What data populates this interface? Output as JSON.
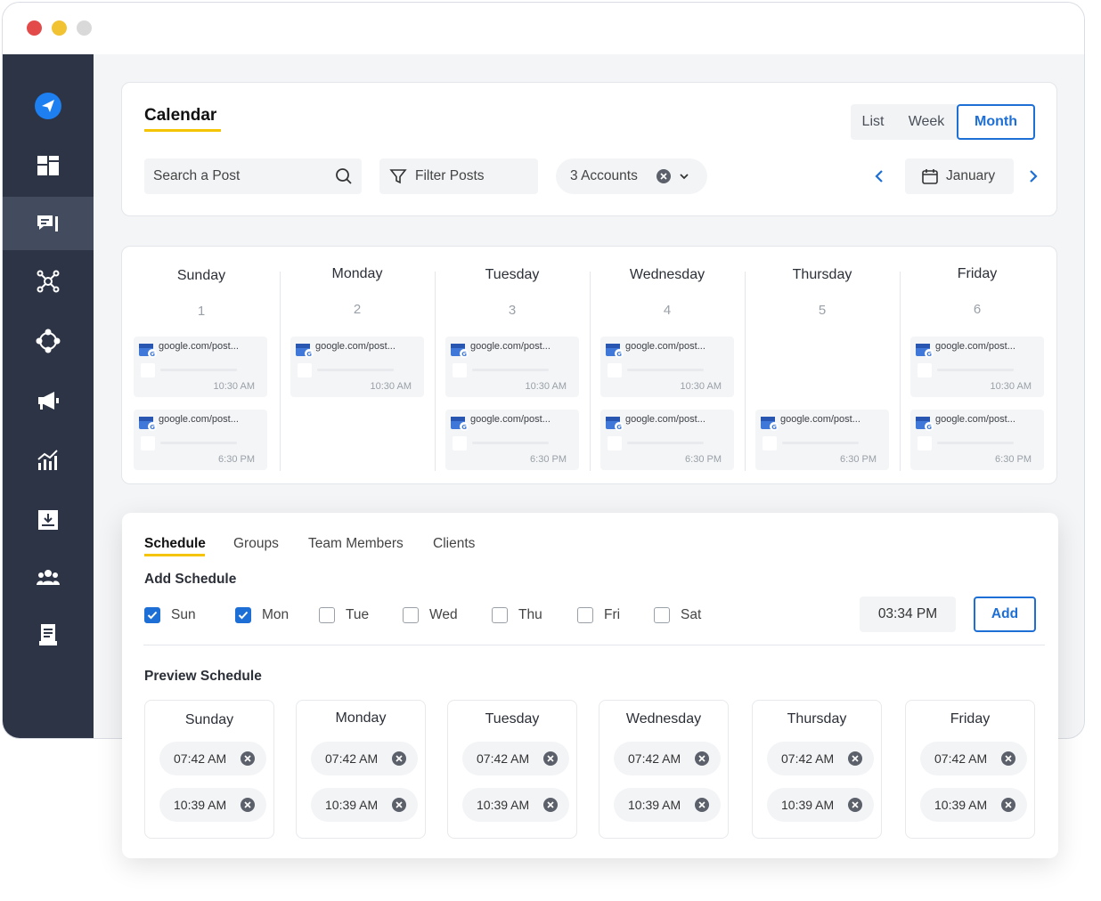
{
  "window": {
    "traffic_lights": [
      "#e34b4b",
      "#f1c232",
      "#d9d9d9"
    ]
  },
  "sidebar": {
    "items": [
      {
        "icon": "send-logo-icon"
      },
      {
        "icon": "dashboard-icon"
      },
      {
        "icon": "posts-icon",
        "active": true
      },
      {
        "icon": "network-icon"
      },
      {
        "icon": "integrations-icon"
      },
      {
        "icon": "megaphone-icon"
      },
      {
        "icon": "analytics-icon"
      },
      {
        "icon": "inbox-download-icon"
      },
      {
        "icon": "team-icon"
      },
      {
        "icon": "reports-icon"
      }
    ]
  },
  "calendar": {
    "title": "Calendar",
    "views": [
      "List",
      "Week",
      "Month"
    ],
    "active_view": "Month",
    "search_placeholder": "Search a Post",
    "filter_label": "Filter Posts",
    "accounts_label": "3 Accounts",
    "month_label": "January",
    "days": [
      {
        "name": "Sunday",
        "num": "1",
        "posts": [
          {
            "url": "google.com/post...",
            "time": "10:30 AM"
          },
          {
            "url": "google.com/post...",
            "time": "6:30 PM"
          }
        ]
      },
      {
        "name": "Monday",
        "num": "2",
        "posts": [
          {
            "url": "google.com/post...",
            "time": "10:30 AM"
          }
        ]
      },
      {
        "name": "Tuesday",
        "num": "3",
        "posts": [
          {
            "url": "google.com/post...",
            "time": "10:30 AM"
          },
          {
            "url": "google.com/post...",
            "time": "6:30 PM"
          }
        ]
      },
      {
        "name": "Wednesday",
        "num": "4",
        "posts": [
          {
            "url": "google.com/post...",
            "time": "10:30 AM"
          },
          {
            "url": "google.com/post...",
            "time": "6:30 PM"
          }
        ]
      },
      {
        "name": "Thursday",
        "num": "5",
        "posts": [
          {
            "url": "google.com/post...",
            "time": "6:30 PM"
          }
        ]
      },
      {
        "name": "Friday",
        "num": "6",
        "posts": [
          {
            "url": "google.com/post...",
            "time": "10:30 AM"
          },
          {
            "url": "google.com/post...",
            "time": "6:30 PM"
          }
        ]
      }
    ]
  },
  "schedule": {
    "tabs": [
      "Schedule",
      "Groups",
      "Team Members",
      "Clients"
    ],
    "active_tab": "Schedule",
    "add_heading": "Add Schedule",
    "weekdays": [
      {
        "label": "Sun",
        "checked": true
      },
      {
        "label": "Mon",
        "checked": true
      },
      {
        "label": "Tue",
        "checked": false
      },
      {
        "label": "Wed",
        "checked": false
      },
      {
        "label": "Thu",
        "checked": false
      },
      {
        "label": "Fri",
        "checked": false
      },
      {
        "label": "Sat",
        "checked": false
      }
    ],
    "time_value": "03:34 PM",
    "add_label": "Add",
    "preview_heading": "Preview Schedule",
    "preview": [
      {
        "day": "Sunday",
        "times": [
          "07:42 AM",
          "10:39 AM"
        ]
      },
      {
        "day": "Monday",
        "times": [
          "07:42 AM",
          "10:39 AM"
        ]
      },
      {
        "day": "Tuesday",
        "times": [
          "07:42 AM",
          "10:39 AM"
        ]
      },
      {
        "day": "Wednesday",
        "times": [
          "07:42 AM",
          "10:39 AM"
        ]
      },
      {
        "day": "Thursday",
        "times": [
          "07:42 AM",
          "10:39 AM"
        ]
      },
      {
        "day": "Friday",
        "times": [
          "07:42 AM",
          "10:39 AM"
        ]
      }
    ]
  },
  "colors": {
    "accent": "#1d6fd6",
    "highlight": "#f5c400",
    "sidebar": "#2d3446"
  }
}
